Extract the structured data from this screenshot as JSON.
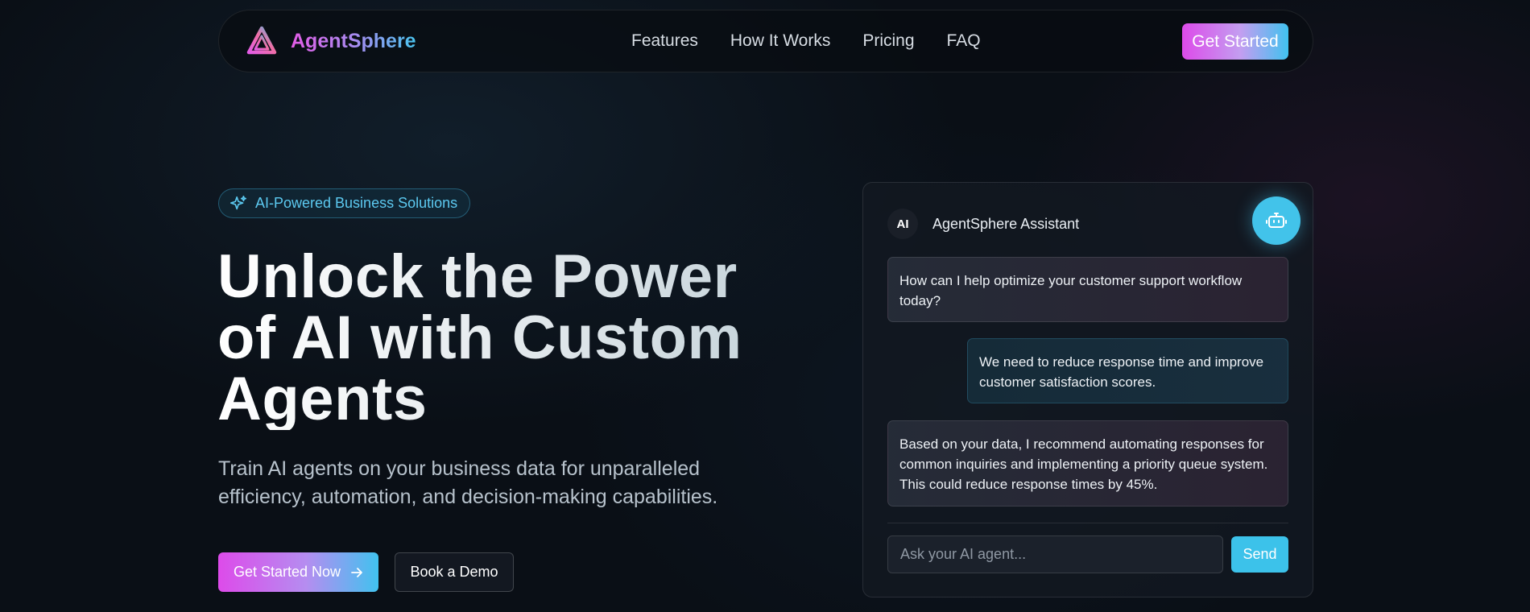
{
  "nav": {
    "brand": "AgentSphere",
    "links": [
      "Features",
      "How It Works",
      "Pricing",
      "FAQ"
    ],
    "cta": "Get Started"
  },
  "hero": {
    "badge": "AI-Powered Business Solutions",
    "headline": "Unlock the Power of AI with Custom Agents",
    "subhead": "Train AI agents on your business data for unparalleled efficiency, automation, and decision-making capabilities.",
    "primary_cta": "Get Started Now",
    "secondary_cta": "Book a Demo"
  },
  "chat": {
    "avatar": "AI",
    "assistant_name": "AgentSphere Assistant",
    "messages": [
      "How can I help optimize your customer support workflow today?",
      "We need to reduce response time and improve customer satisfaction scores.",
      "Based on your data, I recommend automating responses for common inquiries and implementing a priority queue system. This could reduce response times by 45%."
    ],
    "input_placeholder": "Ask your AI agent...",
    "send": "Send"
  },
  "colors": {
    "accent_pink": "#dd4bea",
    "accent_cyan": "#42c3ea",
    "background": "#0a0f16"
  },
  "icons": {
    "logo": "triangle-logo-icon",
    "badge": "sparkles-icon",
    "cta_arrow": "arrow-right-icon",
    "assistant": "robot-icon"
  }
}
